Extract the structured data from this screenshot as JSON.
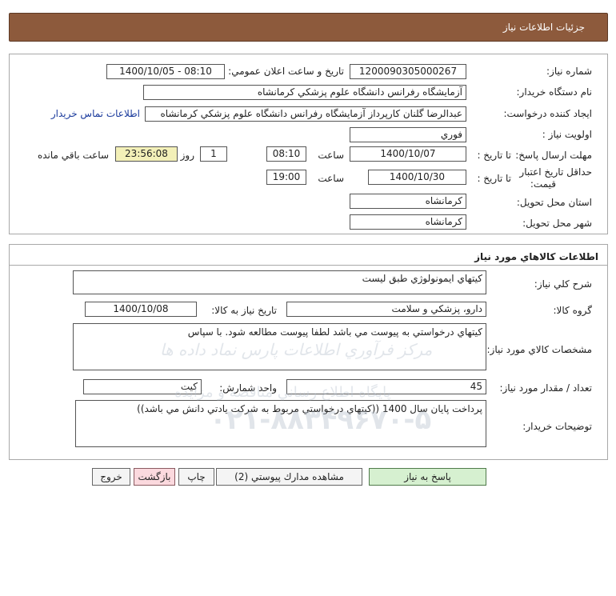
{
  "header": {
    "title": "جزئيات اطلاعات نياز"
  },
  "need_info": {
    "need_number": {
      "label": "شماره نياز:",
      "value": "1200090305000267"
    },
    "announce": {
      "label": "تاريخ و ساعت اعلان عمومي:",
      "value": "1400/10/05 - 08:10"
    },
    "buyer_org": {
      "label": "نام دستگاه خريدار:",
      "value": "آزمايشگاه رفرانس دانشگاه علوم پزشكي كرمانشاه"
    },
    "requester": {
      "label": "ايجاد كننده درخواست:",
      "value": "عبدالرضا گلنان كارپرداز آزمايشگاه رفرانس دانشگاه علوم پزشكي كرمانشاه",
      "contact_link": "اطلاعات تماس خريدار"
    },
    "priority": {
      "label": "اولويت نياز :",
      "value": "فوري"
    },
    "deadline": {
      "label": "مهلت ارسال پاسخ:",
      "to_date_label": "تا تاريخ :",
      "date": "1400/10/07",
      "time_label": "ساعت",
      "time": "08:10",
      "days": "1",
      "days_label": "روز و",
      "remaining": "23:56:08",
      "remaining_label": "ساعت باقي مانده"
    },
    "validity": {
      "label_line1": "حداقل تاريخ اعتبار",
      "label_line2": "قيمت:",
      "to_date_label": "تا تاريخ :",
      "date": "1400/10/30",
      "time_label": "ساعت",
      "time": "19:00"
    },
    "province": {
      "label": "استان محل تحويل:",
      "value": "كرمانشاه"
    },
    "city": {
      "label": "شهر محل تحويل:",
      "value": "كرمانشاه"
    }
  },
  "goods": {
    "title": "اطلاعات كالاهاي مورد نياز",
    "general_desc": {
      "label": "شرح كلي نياز:",
      "value": "كيتهاي ايمونولوژي طبق ليست"
    },
    "group": {
      "label": "گروه كالا:",
      "value": "دارو، پزشكي و سلامت"
    },
    "need_date": {
      "label": "تاريخ نياز به كالا:",
      "value": "1400/10/08"
    },
    "specs": {
      "label": "مشخصات كالاي مورد نياز:",
      "value": "كيتهاي درخواستي به پيوست مي باشد لطفا پيوست مطالعه شود.  با سپاس"
    },
    "quantity": {
      "label": "تعداد / مقدار مورد نياز:",
      "value": "45"
    },
    "unit": {
      "label": "واحد شمارش:",
      "value": "كيت"
    },
    "buyer_notes": {
      "label": "توضيحات خريدار:",
      "value": "پرداخت پايان سال 1400 ((كيتهاي درخواستي مربوط به شركت يادتي دانش مي باشد))"
    }
  },
  "buttons": {
    "reply": "پاسخ به نياز",
    "attachments": "مشاهده مدارك پيوستي (2)",
    "print": "چاپ",
    "back": "بازگشت",
    "exit": "خروج"
  },
  "watermark": {
    "line1": "مركز فرآوري اطلاعات پارس نماد داده ها",
    "line2": "پايگاه اطلاع رساني مناقصه و مزايده",
    "phone": "۰۲۱-۸۸۳۴۹۶۷۰-۵"
  },
  "colors": {
    "header_bg": "#8d5a3c",
    "remaining_bg": "#f3f0b8",
    "reply_btn": "#d6f0d0",
    "back_btn": "#fbd9de",
    "link": "#1a3a9c"
  }
}
